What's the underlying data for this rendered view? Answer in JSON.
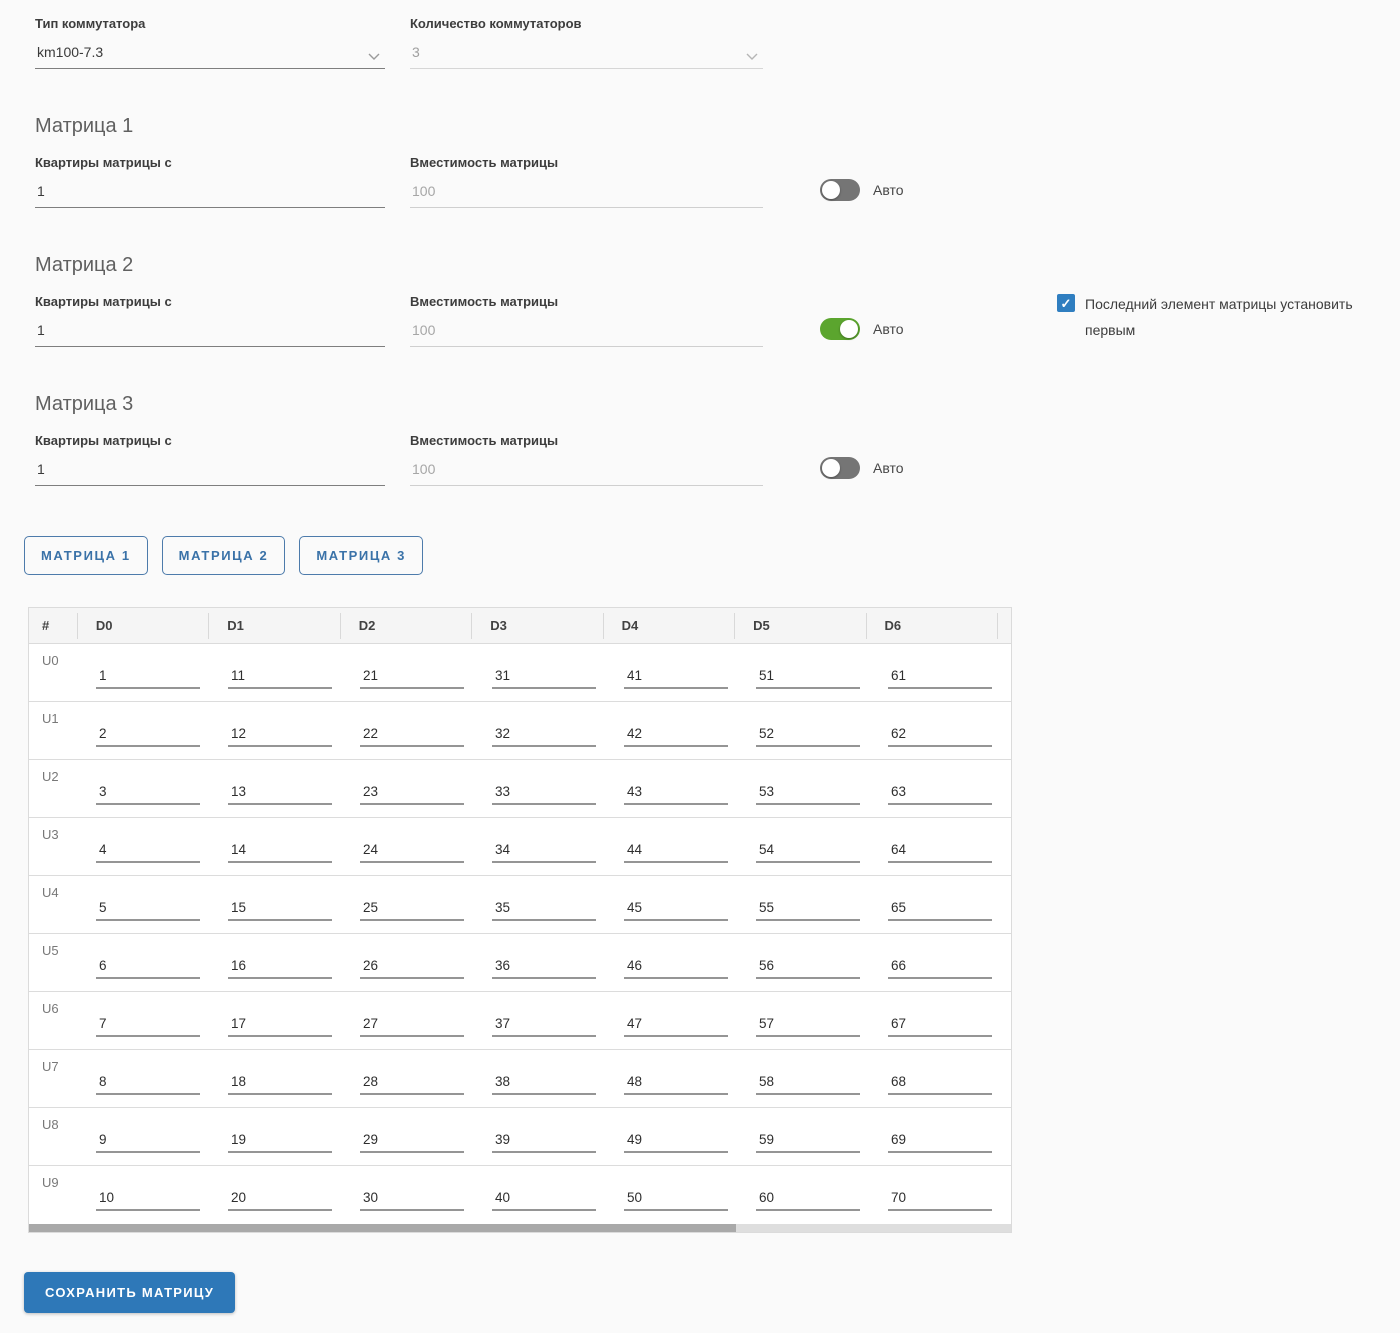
{
  "colors": {
    "primary_blue": "#2e78b8",
    "tab_blue": "#3a72a8",
    "checkbox_blue": "#2f7ec0",
    "toggle_on_green": "#5ba52e",
    "toggle_off_gray": "#757575",
    "page_background": "#fafafa"
  },
  "top_fields": {
    "switch_type": {
      "label": "Тип коммутатора",
      "value": "km100-7.3"
    },
    "switch_count": {
      "label": "Количество коммутаторов",
      "value": "3",
      "disabled": true
    }
  },
  "sections": [
    {
      "title": "Матрица 1",
      "apartments_label": "Квартиры матрицы с",
      "apartments_value": "1",
      "capacity_label": "Вместимость матрицы",
      "capacity_placeholder": "100",
      "auto_label": "Авто",
      "auto_on": false
    },
    {
      "title": "Матрица 2",
      "apartments_label": "Квартиры матрицы с",
      "apartments_value": "1",
      "capacity_label": "Вместимость матрицы",
      "capacity_placeholder": "100",
      "auto_label": "Авто",
      "auto_on": true
    },
    {
      "title": "Матрица 3",
      "apartments_label": "Квартиры матрицы с",
      "apartments_value": "1",
      "capacity_label": "Вместимость матрицы",
      "capacity_placeholder": "100",
      "auto_label": "Авто",
      "auto_on": false
    }
  ],
  "checkbox": {
    "checked": true,
    "check_glyph": "✓",
    "label": "Последний элемент матрицы установить первым"
  },
  "tabs": [
    {
      "label": "МАТРИЦА 1"
    },
    {
      "label": "МАТРИЦА 2"
    },
    {
      "label": "МАТРИЦА 3"
    }
  ],
  "table": {
    "corner_header": "#",
    "column_headers": [
      "D0",
      "D1",
      "D2",
      "D3",
      "D4",
      "D5",
      "D6"
    ],
    "rows": [
      {
        "label": "U0",
        "values": [
          "1",
          "11",
          "21",
          "31",
          "41",
          "51",
          "61"
        ]
      },
      {
        "label": "U1",
        "values": [
          "2",
          "12",
          "22",
          "32",
          "42",
          "52",
          "62"
        ]
      },
      {
        "label": "U2",
        "values": [
          "3",
          "13",
          "23",
          "33",
          "43",
          "53",
          "63"
        ]
      },
      {
        "label": "U3",
        "values": [
          "4",
          "14",
          "24",
          "34",
          "44",
          "54",
          "64"
        ]
      },
      {
        "label": "U4",
        "values": [
          "5",
          "15",
          "25",
          "35",
          "45",
          "55",
          "65"
        ]
      },
      {
        "label": "U5",
        "values": [
          "6",
          "16",
          "26",
          "36",
          "46",
          "56",
          "66"
        ]
      },
      {
        "label": "U6",
        "values": [
          "7",
          "17",
          "27",
          "37",
          "47",
          "57",
          "67"
        ]
      },
      {
        "label": "U7",
        "values": [
          "8",
          "18",
          "28",
          "38",
          "48",
          "58",
          "68"
        ]
      },
      {
        "label": "U8",
        "values": [
          "9",
          "19",
          "29",
          "39",
          "49",
          "59",
          "69"
        ]
      },
      {
        "label": "U9",
        "values": [
          "10",
          "20",
          "30",
          "40",
          "50",
          "60",
          "70"
        ]
      }
    ]
  },
  "scrollbar": {
    "thumb_percent": 72
  },
  "save_button": {
    "label": "СОХРАНИТЬ МАТРИЦУ"
  }
}
